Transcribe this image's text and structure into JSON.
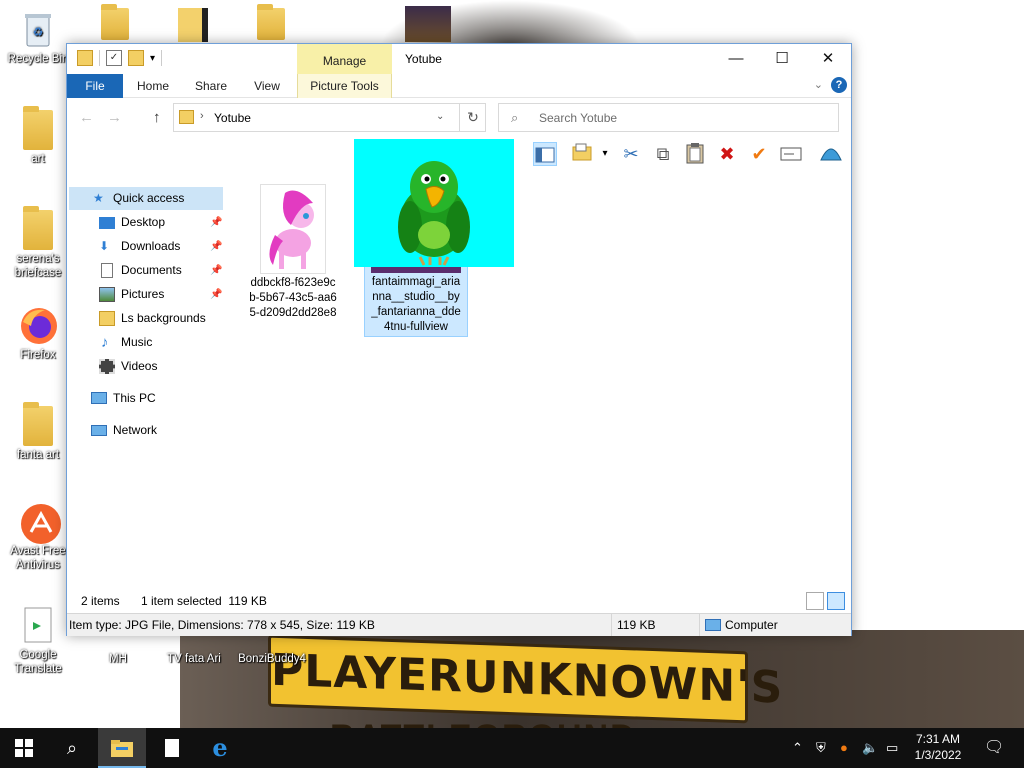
{
  "desktop": {
    "icons": [
      {
        "label": "Recycle Bin"
      },
      {
        "label": "art"
      },
      {
        "label": "serena's briefcase"
      },
      {
        "label": "Firefox"
      },
      {
        "label": "fanta art"
      },
      {
        "label": "Avast Free Antivirus"
      },
      {
        "label": "Google Translate"
      },
      {
        "label": "MH"
      },
      {
        "label": "TV fata Ari"
      },
      {
        "label": "BonziBuddy4"
      }
    ],
    "wallpaper_text": "PLAYERUNKNOWN'S",
    "wallpaper_text_bottom": "BATTLEGROUND"
  },
  "window": {
    "title": "Yotube",
    "manage_tab": "Manage",
    "ribbon_tabs": [
      "File",
      "Home",
      "Share",
      "View",
      "Picture Tools"
    ],
    "controls": {
      "minimize": "—",
      "maximize": "☐",
      "close": "✕"
    },
    "help": "?"
  },
  "navbar": {
    "address_path": "Yotube",
    "search_placeholder": "Search Yotube"
  },
  "nav_pane": {
    "quick_access": "Quick access",
    "items": [
      {
        "label": "Desktop",
        "pinned": true
      },
      {
        "label": "Downloads",
        "pinned": true
      },
      {
        "label": "Documents",
        "pinned": true
      },
      {
        "label": "Pictures",
        "pinned": true
      },
      {
        "label": "Ls backgrounds",
        "pinned": false
      },
      {
        "label": "Music",
        "pinned": false
      },
      {
        "label": "Videos",
        "pinned": false
      }
    ],
    "this_pc": "This PC",
    "network": "Network"
  },
  "files": [
    {
      "name": "ddbckf8-f623e9cb-5b67-43c5-aa65-d209d2dd28e8",
      "lines": [
        "ddbckf8-f623e9c",
        "b-5b67-43c5-aa6",
        "5-d209d2dd28e8"
      ],
      "selected": false
    },
    {
      "name": "fantaimmagi_arianna__studio__by_fantarianna_dde4tnu-fullview",
      "lines": [
        "fantaimmagi_aria",
        "nna__studio__by",
        "_fantarianna_dde",
        "4tnu-fullview"
      ],
      "selected": true
    }
  ],
  "status": {
    "item_count": "2 items",
    "selection": "1 item selected  119 KB"
  },
  "infobar": {
    "details": "Item type: JPG File, Dimensions: 778 x 545, Size: 119 KB",
    "size": "119 KB",
    "location": "Computer"
  },
  "taskbar": {
    "time": "7:31 AM",
    "date": "1/3/2022"
  },
  "colors": {
    "accent": "#1a67b6",
    "selection": "#cce8ff",
    "manage_tab": "#f8f0a8",
    "drag_preview_bg": "#00ffff"
  }
}
